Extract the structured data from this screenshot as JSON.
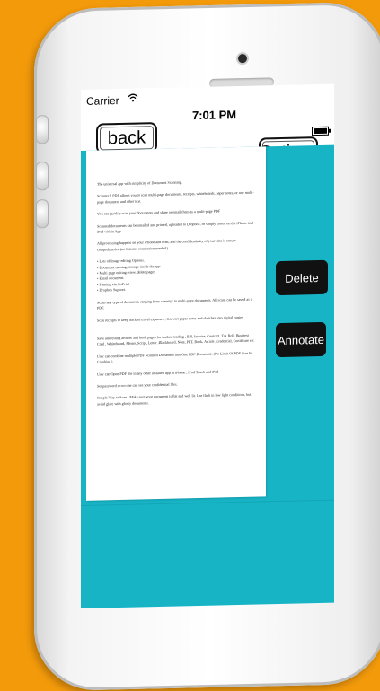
{
  "status_bar": {
    "carrier": "Carrier",
    "time": "7:01 PM"
  },
  "nav": {
    "back_label": "back",
    "options_label": "Options"
  },
  "actions": {
    "delete_label": "Delete",
    "annotate_label": "Annotate"
  },
  "document": {
    "paragraphs": [
      "The universal app with simplicity of Document Scanning.",
      "Scanner 2 PDF allows you to scan multi-page documents, receipts, whiteboards, paper notes, or any multi-page document and other text.",
      "You can quickly scan your documents and share or email them as a multi-page PDF",
      "Scanned documents can be emailed and printed, uploaded to Dropbox, or simply stored on the iPhone and iPad within App.",
      "All processing happens on your iPhone and iPad, and the confidentiality of your data is ensure comprehensive (no Internet connection needed.)",
      "• Lots of Image editing Options.\n• Document naming, storage inside the app\n• Multi page editing: view, delete pages\n• Email document.\n• Printing via AirPrint\n• Dropbox Support.",
      "Scans any type of document, ranging from a receipt to multi-page documents. All scans can be saved as a PDF.",
      "Scan receipts to keep track of travel expenses , Convert paper notes and sketches into digital copies",
      "Save interesting articles and book pages for further reading , Bill, Invoice, Contract, Tax Roll, Business Card , Whiteboard, Memo, Script, Letter ,Blackboard, Note, PPT, Book, Article ,Credential, Certificate etc",
      "User can combine multiple PDF Scanned Document into One PDF Document. (No Limit Of PDF Size In Combine )",
      "User can Open PDF file in any other installed app in iPhone , iPod Touch and iPad",
      "Set password so no one can see your confidential files.",
      "Simple Way to Scan : Make sure your document is flat and well lit. Use flash in low light conditions, but avoid glare with glossy documents."
    ]
  },
  "colors": {
    "background": "#f39a0b",
    "accent": "#17b4c6",
    "button_dark": "#111111"
  },
  "icons": {
    "wifi": "wifi-icon",
    "battery": "battery-icon"
  }
}
